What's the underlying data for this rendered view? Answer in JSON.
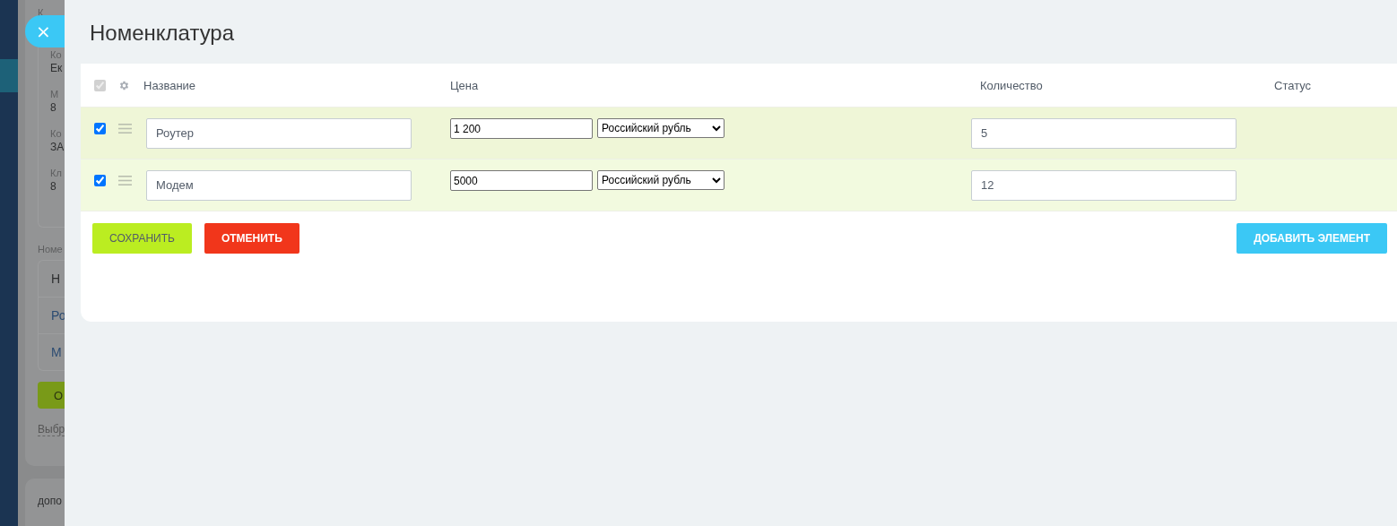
{
  "background": {
    "top_label": "К",
    "fields": [
      {
        "label": "Ко",
        "value": "Ек"
      },
      {
        "label": "М",
        "value": "8"
      },
      {
        "label": "Ко",
        "value": "ЗА"
      },
      {
        "label": "Кл",
        "value": "8"
      }
    ],
    "section_label": "Номе",
    "items": [
      {
        "text": "Н",
        "kind": "plain"
      },
      {
        "text": "Ро",
        "kind": "link"
      },
      {
        "text": "М",
        "kind": "link"
      }
    ],
    "button": "О",
    "link": "Выбр",
    "next_section": "допо"
  },
  "close_button": "×",
  "title": "Номенклатура",
  "table": {
    "header_checkbox": {
      "checked": true,
      "disabled": true
    },
    "columns": [
      {
        "label": "Название"
      },
      {
        "label": "Цена"
      },
      {
        "label": "Количество"
      },
      {
        "label": "Статус"
      }
    ],
    "rows": [
      {
        "checked": true,
        "name": "Роутер",
        "price": "1 200",
        "currency": "Российский рубль",
        "quantity": "5"
      },
      {
        "checked": true,
        "name": "Модем",
        "price": "5000",
        "currency": "Российский рубль",
        "quantity": "12"
      }
    ]
  },
  "buttons": [
    {
      "label": "СОХРАНИТЬ",
      "kind": "save"
    },
    {
      "label": "ОТМЕНИТЬ",
      "kind": "cancel"
    },
    {
      "label": "ДОБАВИТЬ ЭЛЕМЕНТ",
      "kind": "add"
    }
  ]
}
